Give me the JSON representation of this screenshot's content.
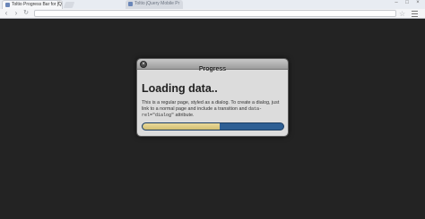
{
  "browser": {
    "tabs": [
      {
        "title": "Toltio Progress Bar for jQ",
        "active": true
      },
      {
        "title": "Toltio jQuery Mobile Pr",
        "active": false
      }
    ]
  },
  "dialog": {
    "title": "Progress",
    "close_icon": "close-icon",
    "heading": "Loading data..",
    "body_text_1": "This is a regular page, styled as a dialog. To create a dialog, just link to a normal page and include a transition and ",
    "body_code_1": "data-",
    "body_code_2": "rel=\"dialog\"",
    "body_text_2": " attribute.",
    "progress_fraction": 0.55,
    "progress_fill_color": "#e3d085",
    "progress_track_color": "#2e5f94"
  }
}
